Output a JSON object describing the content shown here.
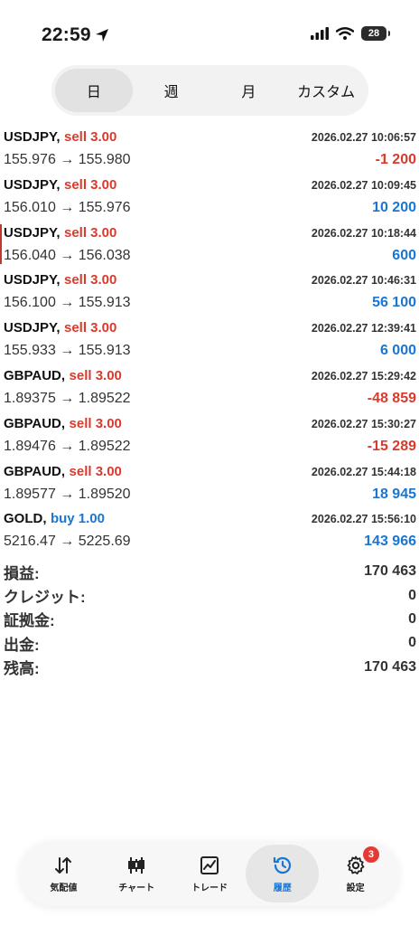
{
  "status_bar": {
    "time": "22:59",
    "battery": "28"
  },
  "period_tabs": [
    {
      "label": "日",
      "active": true
    },
    {
      "label": "週",
      "active": false
    },
    {
      "label": "月",
      "active": false
    },
    {
      "label": "カスタム",
      "active": false
    }
  ],
  "deals": [
    {
      "symbol": "USDJPY,",
      "side": "sell 3.00",
      "time": "2026.02.27 10:06:57",
      "prices": "155.976 → 155.980",
      "profit": "-1 200"
    },
    {
      "symbol": "USDJPY,",
      "side": "sell 3.00",
      "time": "2026.02.27 10:09:45",
      "prices": "156.010 → 155.976",
      "profit": "10 200"
    },
    {
      "symbol": "USDJPY,",
      "side": "sell 3.00",
      "time": "2026.02.27 10:18:44",
      "prices": "156.040 → 156.038",
      "profit": "600"
    },
    {
      "symbol": "USDJPY,",
      "side": "sell 3.00",
      "time": "2026.02.27 10:46:31",
      "prices": "156.100 → 155.913",
      "profit": "56 100"
    },
    {
      "symbol": "USDJPY,",
      "side": "sell 3.00",
      "time": "2026.02.27 12:39:41",
      "prices": "155.933 → 155.913",
      "profit": "6 000"
    },
    {
      "symbol": "GBPAUD,",
      "side": "sell 3.00",
      "time": "2026.02.27 15:29:42",
      "prices": "1.89375 → 1.89522",
      "profit": "-48 859"
    },
    {
      "symbol": "GBPAUD,",
      "side": "sell 3.00",
      "time": "2026.02.27 15:30:27",
      "prices": "1.89476 → 1.89522",
      "profit": "-15 289"
    },
    {
      "symbol": "GBPAUD,",
      "side": "sell 3.00",
      "time": "2026.02.27 15:44:18",
      "prices": "1.89577 → 1.89520",
      "profit": "18 945"
    },
    {
      "symbol": "GOLD,",
      "side": "buy 1.00",
      "time": "2026.02.27 15:56:10",
      "prices": "5216.47 → 5225.69",
      "profit": "143 966"
    }
  ],
  "summary": [
    {
      "label": "損益:",
      "value": "170 463"
    },
    {
      "label": "クレジット:",
      "value": "0"
    },
    {
      "label": "証拠金:",
      "value": "0"
    },
    {
      "label": "出金:",
      "value": "0"
    },
    {
      "label": "残高:",
      "value": "170 463"
    }
  ],
  "nav": [
    {
      "label": "気配値",
      "icon": "arrows-updown-icon"
    },
    {
      "label": "チャート",
      "icon": "candlestick-icon"
    },
    {
      "label": "トレード",
      "icon": "trade-chart-icon"
    },
    {
      "label": "履歴",
      "icon": "history-icon"
    },
    {
      "label": "設定",
      "icon": "gear-icon",
      "badge": "3"
    }
  ],
  "colors": {
    "sell": "#d93a2b",
    "buy": "#1976d2",
    "negative": "#d93a2b",
    "positive": "#1976d2",
    "active_nav": "#1976d2"
  }
}
